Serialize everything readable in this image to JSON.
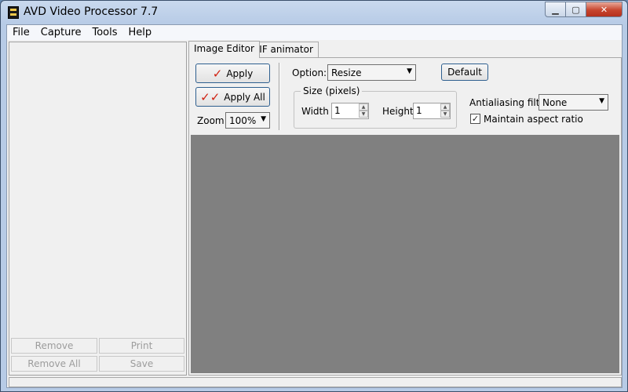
{
  "window": {
    "title": "AVD Video Processor 7.7"
  },
  "menu": {
    "items": [
      "File",
      "Capture",
      "Tools",
      "Help"
    ]
  },
  "left_panel": {
    "buttons": {
      "remove": "Remove",
      "print": "Print",
      "remove_all": "Remove All",
      "save": "Save"
    }
  },
  "tabs": [
    {
      "label": "Image Editor",
      "active": true
    },
    {
      "label": "GIF animator",
      "active": false
    }
  ],
  "editor": {
    "apply_label": "Apply",
    "apply_all_label": "Apply All",
    "zoom_label": "Zoom:",
    "zoom_value": "100%",
    "option_label": "Option:",
    "option_value": "Resize",
    "default_label": "Default",
    "size_group_label": "Size (pixels)",
    "width_label": "Width",
    "width_value": "1",
    "height_label": "Height",
    "height_value": "1",
    "antialias_label": "Antialiasing filter:",
    "antialias_value": "None",
    "aspect_label": "Maintain aspect ratio",
    "aspect_checked": true
  },
  "colors": {
    "preview_bg": "#808080",
    "apply_check": "#d02010"
  }
}
